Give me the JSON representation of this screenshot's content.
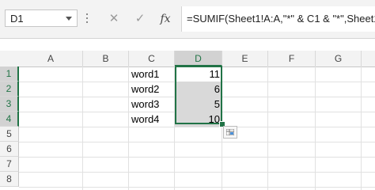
{
  "formula_bar": {
    "name_box": "D1",
    "cancel_symbol": "✕",
    "enter_symbol": "✓",
    "fx_label": "fx",
    "formula": "=SUMIF(Sheet1!A:A,\"*\" & C1 & \"*\",Sheet1!"
  },
  "columns": [
    "A",
    "B",
    "C",
    "D",
    "E",
    "F",
    "G"
  ],
  "selected_column": "D",
  "rows": [
    "1",
    "2",
    "3",
    "4",
    "5",
    "6",
    "7",
    "8"
  ],
  "selected_rows": [
    "1",
    "2",
    "3",
    "4"
  ],
  "cells": {
    "C1": "word1",
    "C2": "word2",
    "C3": "word3",
    "C4": "word4",
    "D1": "11",
    "D2": "6",
    "D3": "5",
    "D4": "10"
  },
  "colors": {
    "accent": "#217346",
    "selection_fill": "#d9d9d9",
    "header_bg": "#f3f3f3"
  },
  "icons": {
    "quick_analysis": "quick-analysis-icon",
    "name_box_dropdown": "chevron-down-icon"
  }
}
